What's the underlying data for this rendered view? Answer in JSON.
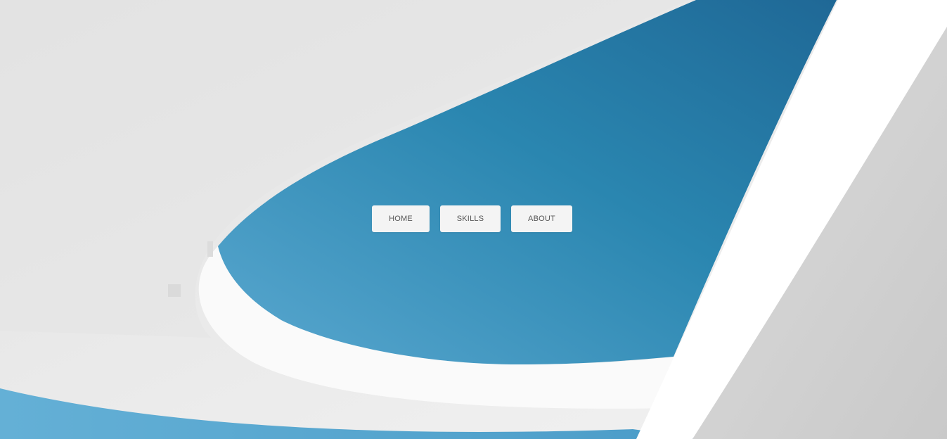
{
  "nav": {
    "items": [
      {
        "label": "HOME"
      },
      {
        "label": "SKILLS"
      },
      {
        "label": "ABOUT"
      }
    ]
  },
  "colors": {
    "sky_light": "#5aa8d0",
    "sky_dark": "#1a6f99",
    "concrete": "#e4e4e4",
    "button_bg": "#f4f4f4",
    "button_text": "#555555"
  },
  "background": {
    "image": "architecture-blue-sky-icon"
  }
}
